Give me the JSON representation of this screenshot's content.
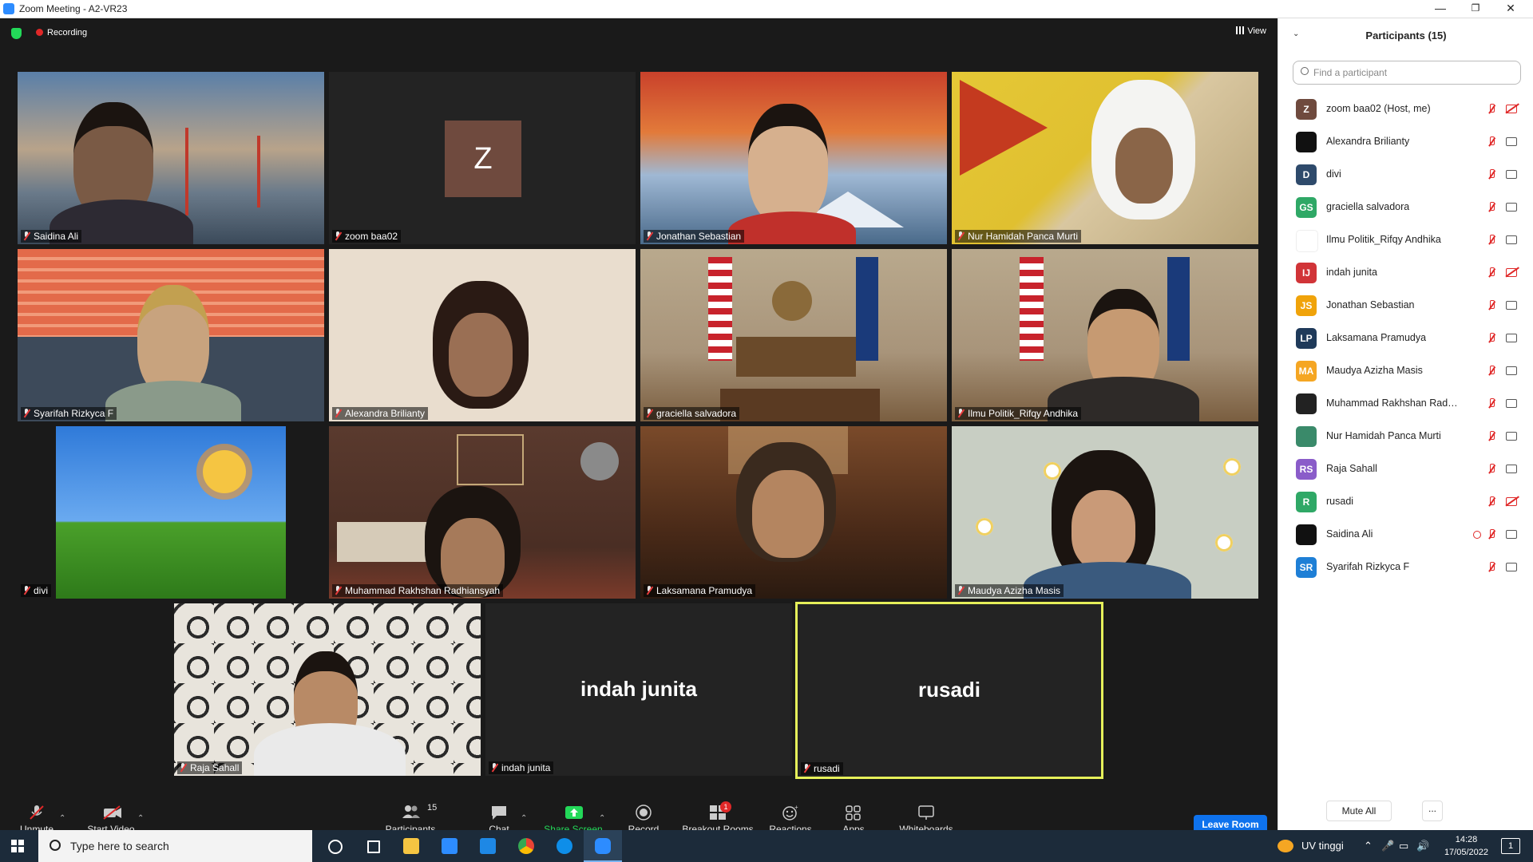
{
  "window": {
    "title": "Zoom Meeting - A2-VR23",
    "minimize": "—",
    "restore": "❐",
    "close": "✕"
  },
  "topbar": {
    "recording": "Recording",
    "view": "View"
  },
  "tiles": [
    {
      "name": "Saidina Ali"
    },
    {
      "name": "zoom baa02",
      "avatar": "Z"
    },
    {
      "name": "Jonathan Sebastian"
    },
    {
      "name": "Nur Hamidah Panca Murti"
    },
    {
      "name": "Syarifah Rizkyca F"
    },
    {
      "name": "Alexandra Brilianty"
    },
    {
      "name": "graciella salvadora"
    },
    {
      "name": "Ilmu Politik_Rifqy Andhika"
    },
    {
      "name": "divi"
    },
    {
      "name": "Muhammad Rakhshan Radhiansyah"
    },
    {
      "name": "Laksamana Pramudya"
    },
    {
      "name": "Maudya Azizha Masis"
    },
    {
      "name": "Raja Sahall"
    },
    {
      "name": "indah junita",
      "big": "indah junita"
    },
    {
      "name": "rusadi",
      "big": "rusadi"
    }
  ],
  "toolbar": {
    "unmute": "Unmute",
    "start_video": "Start Video",
    "participants": "Participants",
    "participants_count": "15",
    "chat": "Chat",
    "share_screen": "Share Screen",
    "record": "Record",
    "breakout_rooms": "Breakout Rooms",
    "breakout_badge": "1",
    "reactions": "Reactions",
    "apps": "Apps",
    "whiteboards": "Whiteboards",
    "leave": "Leave Room"
  },
  "panel": {
    "title": "Participants (15)",
    "search_placeholder": "Find a participant",
    "mute_all": "Mute All",
    "more": "...",
    "participants": [
      {
        "initials": "Z",
        "name": "zoom baa02 (Host, me)",
        "color": "#6f4a3e",
        "video_off": true
      },
      {
        "initials": "",
        "name": "Alexandra Brilianty",
        "color": "#111111",
        "video_off": false
      },
      {
        "initials": "D",
        "name": "divi",
        "color": "#2e4a6b",
        "video_off": false
      },
      {
        "initials": "GS",
        "name": "graciella salvadora",
        "color": "#2fa866",
        "video_off": false
      },
      {
        "initials": "",
        "name": "Ilmu Politik_Rifqy Andhika",
        "color": "#ffffff",
        "video_off": false
      },
      {
        "initials": "IJ",
        "name": "indah junita",
        "color": "#d13438",
        "video_off": true
      },
      {
        "initials": "JS",
        "name": "Jonathan Sebastian",
        "color": "#f0a30a",
        "video_off": false
      },
      {
        "initials": "LP",
        "name": "Laksamana Pramudya",
        "color": "#1f3a5a",
        "video_off": false
      },
      {
        "initials": "MA",
        "name": "Maudya Azizha Masis",
        "color": "#f5a623",
        "video_off": false
      },
      {
        "initials": "",
        "name": "Muhammad Rakhshan Radhiansyah",
        "color": "#222222",
        "video_off": false
      },
      {
        "initials": "",
        "name": "Nur Hamidah Panca Murti",
        "color": "#3a8a6a",
        "video_off": false
      },
      {
        "initials": "RS",
        "name": "Raja Sahall",
        "color": "#8a5cc9",
        "video_off": false
      },
      {
        "initials": "R",
        "name": "rusadi",
        "color": "#2fa866",
        "video_off": true
      },
      {
        "initials": "",
        "name": "Saidina Ali",
        "color": "#111111",
        "video_off": false,
        "sharing": true
      },
      {
        "initials": "SR",
        "name": "Syarifah Rizkyca F",
        "color": "#1e7fd6",
        "video_off": false
      }
    ]
  },
  "taskbar": {
    "search_placeholder": "Type here to search",
    "weather": "UV tinggi",
    "time": "14:28",
    "date": "17/05/2022",
    "notif": "1"
  }
}
